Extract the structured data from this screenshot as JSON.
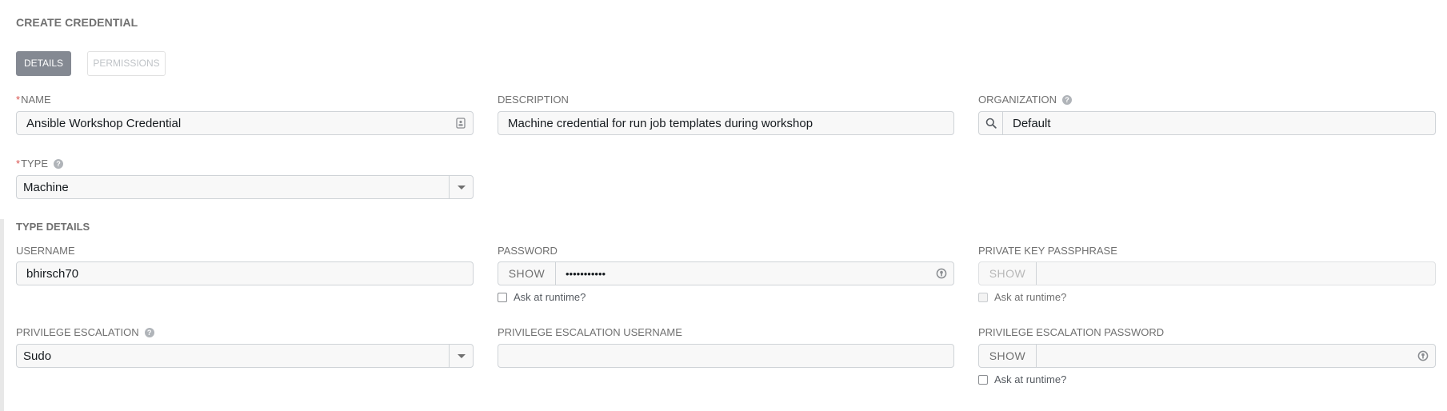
{
  "page": {
    "title": "CREATE CREDENTIAL"
  },
  "tabs": {
    "details": "DETAILS",
    "permissions": "PERMISSIONS"
  },
  "fields": {
    "name": {
      "label": "NAME",
      "value": "Ansible Workshop Credential"
    },
    "description": {
      "label": "DESCRIPTION",
      "value": "Machine credential for run job templates during workshop"
    },
    "organization": {
      "label": "ORGANIZATION",
      "value": "Default"
    },
    "type": {
      "label": "TYPE",
      "value": "Machine"
    }
  },
  "type_details": {
    "title": "TYPE DETAILS",
    "username": {
      "label": "USERNAME",
      "value": "bhirsch70"
    },
    "password": {
      "label": "PASSWORD",
      "show_label": "SHOW",
      "value": "•••••••••••",
      "ask_label": "Ask at runtime?"
    },
    "private_key_passphrase": {
      "label": "PRIVATE KEY PASSPHRASE",
      "show_label": "SHOW",
      "value": "",
      "ask_label": "Ask at runtime?"
    },
    "privilege_escalation": {
      "label": "PRIVILEGE ESCALATION",
      "value": "Sudo"
    },
    "privilege_escalation_username": {
      "label": "PRIVILEGE ESCALATION USERNAME",
      "value": ""
    },
    "privilege_escalation_password": {
      "label": "PRIVILEGE ESCALATION PASSWORD",
      "show_label": "SHOW",
      "value": "",
      "ask_label": "Ask at runtime?"
    }
  },
  "icons": {
    "help": "question-circle-icon",
    "search": "search-icon",
    "caret": "caret-down-icon",
    "key": "key-icon",
    "contact": "contact-card-icon"
  },
  "colors": {
    "active_tab": "#848992",
    "required": "#d9534f",
    "label": "#707070"
  }
}
